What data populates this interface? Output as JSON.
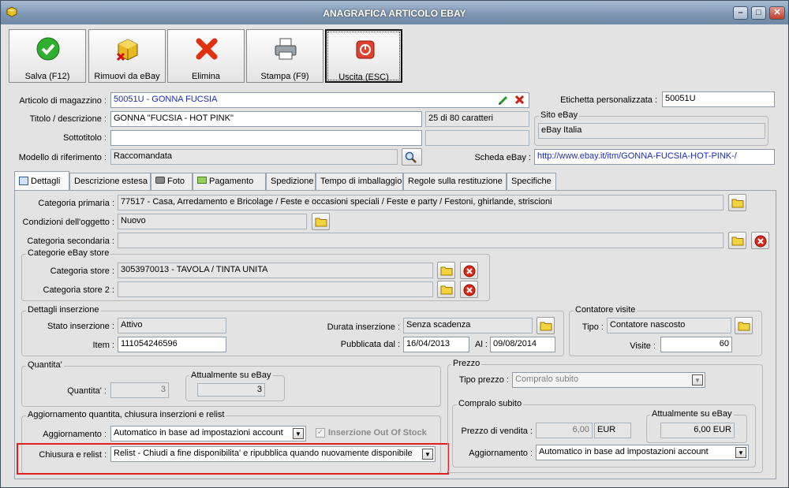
{
  "window": {
    "title": "ANAGRAFICA ARTICOLO EBAY",
    "min": "–",
    "max": "□",
    "close": "✕"
  },
  "toolbar": {
    "save": "Salva (F12)",
    "remove": "Rimuovi da eBay",
    "delete": "Elimina",
    "print": "Stampa (F9)",
    "exit": "Uscita (ESC)"
  },
  "header": {
    "articolo_label": "Articolo di magazzino :",
    "articolo_value": "50051U - GONNA FUCSIA",
    "titolo_label": "Titolo / descrizione :",
    "titolo_value": "GONNA \"FUCSIA - HOT PINK\"",
    "char_count": "25 di 80 caratteri",
    "sottotitolo_label": "Sottotitolo :",
    "sottotitolo_value": "",
    "modello_label": "Modello di riferimento :",
    "modello_value": "Raccomandata",
    "etichetta_label": "Etichetta personalizzata :",
    "etichetta_value": "50051U",
    "sito_group": "Sito eBay",
    "sito_value": "eBay Italia",
    "scheda_label": "Scheda eBay :",
    "scheda_value": "http://www.ebay.it/itm/GONNA-FUCSIA-HOT-PINK-/"
  },
  "tabs": [
    "Dettagli",
    "Descrizione estesa",
    "Foto",
    "Pagamento",
    "Spedizione",
    "Tempo di imballaggio",
    "Regole sulla restituzione",
    "Specifiche"
  ],
  "details": {
    "cat_primaria_label": "Categoria primaria :",
    "cat_primaria_value": "77517 - Casa, Arredamento e Bricolage / Feste e occasioni speciali / Feste e party / Festoni, ghirlande, striscioni",
    "condizioni_label": "Condizioni dell'oggetto :",
    "condizioni_value": "Nuovo",
    "cat_secondaria_label": "Categoria secondaria :",
    "cat_secondaria_value": "",
    "store_group": "Categorie eBay store",
    "store1_label": "Categoria store :",
    "store1_value": "3053970013 - TAVOLA / TINTA UNITA",
    "store2_label": "Categoria store 2 :",
    "store2_value": "",
    "ins_group": "Dettagli inserzione",
    "stato_label": "Stato inserzione :",
    "stato_value": "Attivo",
    "item_label": "Item :",
    "item_value": "111054246596",
    "durata_label": "Durata inserzione :",
    "durata_value": "Senza scadenza",
    "pubblicata_label": "Pubblicata dal :",
    "pubblicata_value": "16/04/2013",
    "al_label": "Al :",
    "al_value": "09/08/2014",
    "contatore_group": "Contatore visite",
    "tipo_label": "Tipo :",
    "tipo_value": "Contatore nascosto",
    "visite_label": "Visite :",
    "visite_value": "60",
    "qty_group": "Quantita'",
    "qty_label": "Quantita' :",
    "qty_value": "3",
    "att_group": "Attualmente su eBay",
    "att_value": "3",
    "agg_group": "Aggiornamento quantita, chiusura inserzioni e relist",
    "agg_label": "Aggiornamento :",
    "agg_value": "Automatico in base ad impostazioni account",
    "oos_label": "Inserzione Out Of Stock",
    "chiusura_label": "Chiusura e relist :",
    "chiusura_value": "Relist - Chiudi a fine disponibilita' e ripubblica quando nuovamente disponibile",
    "prezzo_group": "Prezzo",
    "tipo_prezzo_label": "Tipo prezzo :",
    "tipo_prezzo_value": "Compralo subito",
    "compralo_group": "Compralo subito",
    "pv_label": "Prezzo di vendita :",
    "pv_value": "6,00",
    "pv_cur": "EUR",
    "att2_group": "Attualmente su eBay",
    "att2_value": "6,00 EUR",
    "agg2_label": "Aggiornamento :",
    "agg2_value": "Automatico in base ad impostazioni account"
  }
}
